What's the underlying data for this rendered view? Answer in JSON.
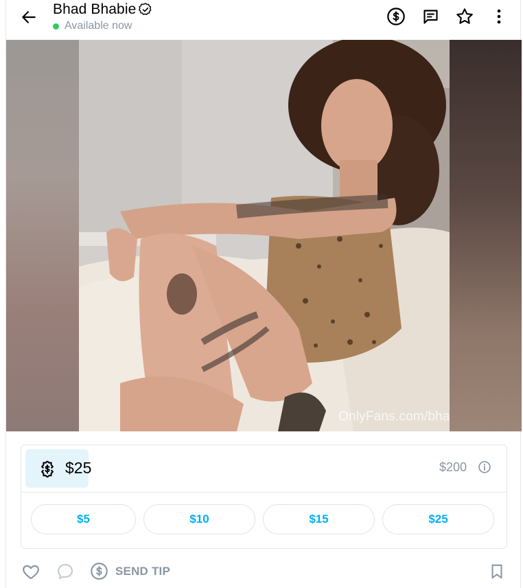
{
  "header": {
    "name": "Bhad Bhabie",
    "status": "Available now",
    "icons": [
      "back-arrow-icon",
      "verified-badge-icon",
      "dollar-circle-icon",
      "message-icon",
      "star-icon",
      "more-vertical-icon"
    ]
  },
  "media": {
    "watermark": "OnlyFans.com/bhadbhabie"
  },
  "tip": {
    "value": "$25",
    "max": "$200",
    "presets": [
      "$5",
      "$10",
      "$15",
      "$25"
    ]
  },
  "bottom": {
    "send_tip_label": "SEND TIP",
    "icons": [
      "heart-icon",
      "comment-icon",
      "dollar-circle-icon",
      "bookmark-icon"
    ]
  },
  "colors": {
    "accent": "#00aff0",
    "muted": "#8a96a3",
    "online": "#2fcb5e",
    "badge_bg": "#e4f4fb",
    "border": "#e5e7ea"
  }
}
